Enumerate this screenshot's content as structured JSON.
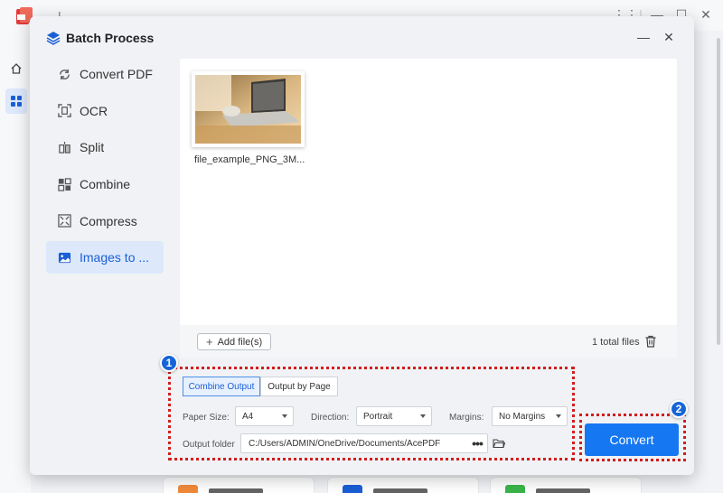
{
  "dialog": {
    "title": "Batch Process"
  },
  "nav": {
    "items": [
      {
        "label": "Convert PDF",
        "icon": "refresh-icon"
      },
      {
        "label": "OCR",
        "icon": "ocr-icon"
      },
      {
        "label": "Split",
        "icon": "split-icon"
      },
      {
        "label": "Combine",
        "icon": "combine-icon"
      },
      {
        "label": "Compress",
        "icon": "compress-icon"
      },
      {
        "label": "Images to ...",
        "icon": "image-icon",
        "active": true
      }
    ]
  },
  "files": {
    "items": [
      {
        "name": "file_example_PNG_3M..."
      }
    ],
    "add_label": "Add file(s)",
    "total": "1 total files"
  },
  "options": {
    "tabs": [
      "Combine Output",
      "Output by Page"
    ],
    "active_tab": "Combine Output",
    "paper_size": {
      "label": "Paper Size:",
      "value": "A4"
    },
    "direction": {
      "label": "Direction:",
      "value": "Portrait"
    },
    "margins": {
      "label": "Margins:",
      "value": "No Margins"
    },
    "output_folder": {
      "label": "Output folder",
      "value": "C:/Users/ADMIN/OneDrive/Documents/AcePDF",
      "more": "•••"
    }
  },
  "convert_label": "Convert",
  "badges": [
    "1",
    "2"
  ],
  "colors": {
    "accent": "#1677f2",
    "highlight": "#d21d1d",
    "active_nav_bg": "#dde8fb",
    "badge": "#1565d8"
  }
}
